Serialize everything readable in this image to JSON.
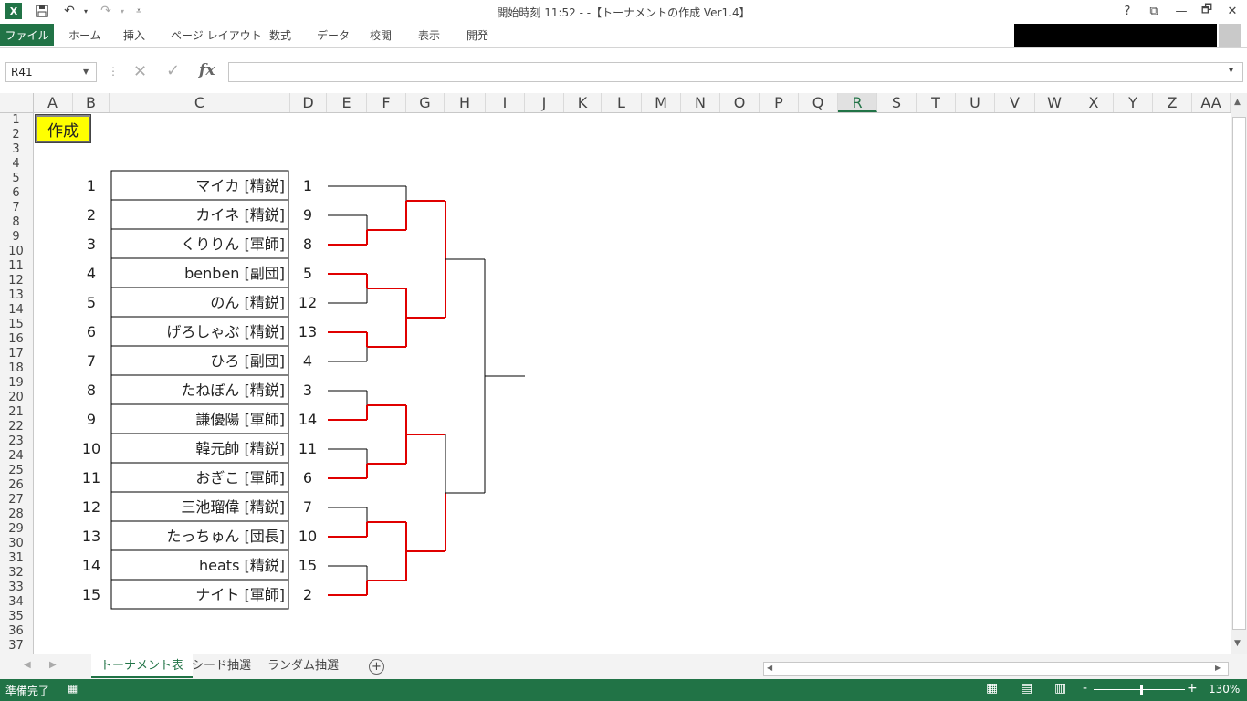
{
  "titlebar": {
    "title": "開始時刻 11:52 - -【トーナメントの作成 Ver1.4】",
    "help": "?",
    "restore_ribbon": "⧉",
    "minimize": "—",
    "maximize": "🗗",
    "close": "✕"
  },
  "ribbon": {
    "file": "ファイル",
    "tabs": [
      "ホーム",
      "挿入",
      "ページ レイアウト",
      "数式",
      "データ",
      "校閲",
      "表示",
      "開発"
    ]
  },
  "formula_bar": {
    "name_box": "R41",
    "cancel_icon": "✕",
    "enter_icon": "✓",
    "fx": "fx",
    "formula": ""
  },
  "columns": [
    "A",
    "B",
    "C",
    "D",
    "E",
    "F",
    "G",
    "H",
    "I",
    "J",
    "K",
    "L",
    "M",
    "N",
    "O",
    "P",
    "Q",
    "R",
    "S",
    "T",
    "U",
    "V",
    "W",
    "X",
    "Y",
    "Z",
    "AA"
  ],
  "selected_column": "R",
  "rows": [
    "1",
    "2",
    "3",
    "4",
    "5",
    "6",
    "7",
    "8",
    "9",
    "10",
    "11",
    "12",
    "13",
    "14",
    "15",
    "16",
    "17",
    "18",
    "19",
    "20",
    "21",
    "22",
    "23",
    "24",
    "25",
    "26",
    "27",
    "28",
    "29",
    "30",
    "31",
    "32",
    "33",
    "34",
    "35",
    "36",
    "37"
  ],
  "make_button": "作成",
  "entries": [
    {
      "no": "1",
      "name": "マイカ [精鋭]",
      "seed": "1"
    },
    {
      "no": "2",
      "name": "カイネ [精鋭]",
      "seed": "9"
    },
    {
      "no": "3",
      "name": "くりりん [軍師]",
      "seed": "8"
    },
    {
      "no": "4",
      "name": "benben [副団]",
      "seed": "5"
    },
    {
      "no": "5",
      "name": "のん [精鋭]",
      "seed": "12"
    },
    {
      "no": "6",
      "name": "げろしゃぶ [精鋭]",
      "seed": "13"
    },
    {
      "no": "7",
      "name": "ひろ [副団]",
      "seed": "4"
    },
    {
      "no": "8",
      "name": "たねぼん [精鋭]",
      "seed": "3"
    },
    {
      "no": "9",
      "name": "謙優陽 [軍師]",
      "seed": "14"
    },
    {
      "no": "10",
      "name": "韓元帥 [精鋭]",
      "seed": "11"
    },
    {
      "no": "11",
      "name": "おぎこ [軍師]",
      "seed": "6"
    },
    {
      "no": "12",
      "name": "三池瑠偉 [精鋭]",
      "seed": "7"
    },
    {
      "no": "13",
      "name": "たっちゅん [団長]",
      "seed": "10"
    },
    {
      "no": "14",
      "name": "heats [精鋭]",
      "seed": "15"
    },
    {
      "no": "15",
      "name": "ナイト [軍師]",
      "seed": "2"
    }
  ],
  "bracket_colors": {
    "winner": "#e00000",
    "normal": "#000000"
  },
  "sheet_tabs": [
    "トーナメント表",
    "シード抽選",
    "ランダム抽選"
  ],
  "active_sheet": "トーナメント表",
  "statusbar": {
    "status": "準備完了",
    "zoom": "130%",
    "zoom_minus": "-",
    "zoom_plus": "+"
  },
  "colors": {
    "accent": "#217346",
    "button": "#ffff00"
  }
}
